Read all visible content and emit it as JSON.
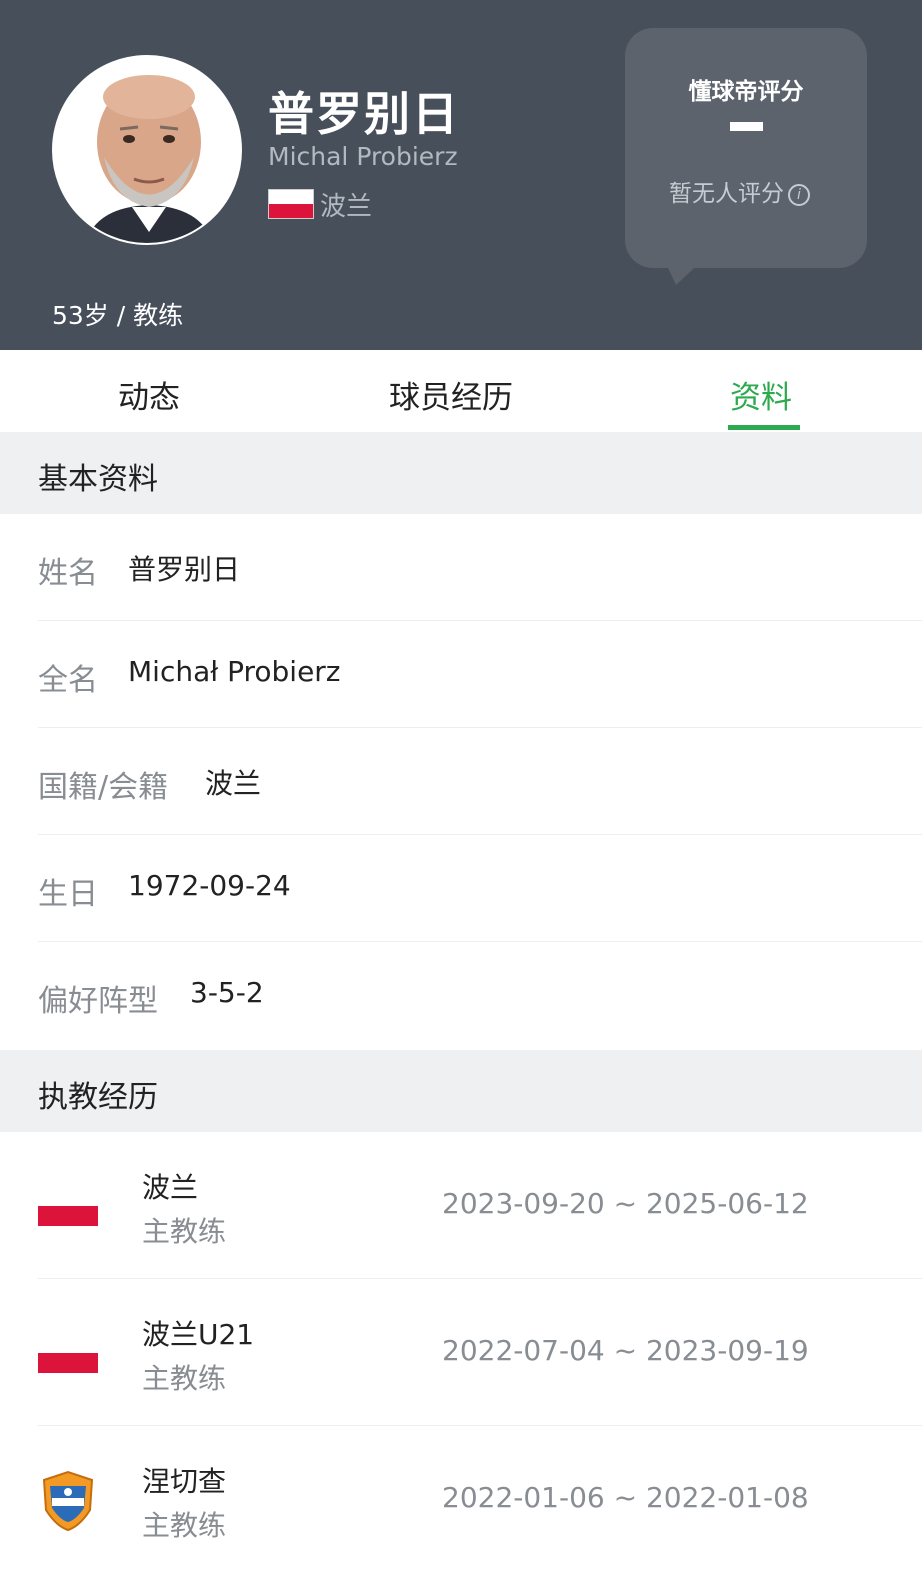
{
  "header": {
    "name_cn": "普罗别日",
    "name_en": "Michal Probierz",
    "country": "波兰",
    "age_role": "53岁 / 教练",
    "rating": {
      "title": "懂球帝评分",
      "value": "-",
      "note": "暂无人评分"
    }
  },
  "tabs": [
    {
      "label": "动态"
    },
    {
      "label": "球员经历"
    },
    {
      "label": "资料",
      "active": true
    }
  ],
  "basic": {
    "title": "基本资料",
    "rows": [
      {
        "label": "姓名",
        "value": "普罗别日"
      },
      {
        "label": "全名",
        "value": "Michał Probierz"
      },
      {
        "label": "国籍/会籍",
        "value": "波兰"
      },
      {
        "label": "生日",
        "value": "1972-09-24"
      },
      {
        "label": "偏好阵型",
        "value": "3-5-2"
      }
    ]
  },
  "career": {
    "title": "执教经历",
    "items": [
      {
        "team": "波兰",
        "role": "主教练",
        "dates": "2023-09-20 ~ 2025-06-12",
        "logo": "poland-flag-icon"
      },
      {
        "team": "波兰U21",
        "role": "主教练",
        "dates": "2022-07-04 ~ 2023-09-19",
        "logo": "poland-flag-icon"
      },
      {
        "team": "涅切查",
        "role": "主教练",
        "dates": "2022-01-06 ~ 2022-01-08",
        "logo": "club-crest-icon"
      }
    ]
  },
  "colors": {
    "header_bg": "#474f5a",
    "accent": "#2daa4f",
    "poland_red": "#dc143c"
  }
}
